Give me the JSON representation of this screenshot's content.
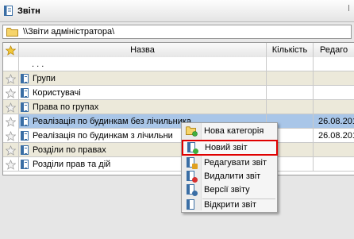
{
  "window": {
    "title": "Звітн"
  },
  "path": {
    "text": "\\\\Звіти адміністратора\\"
  },
  "columns": {
    "name": "Назва",
    "count": "Кількість",
    "edit": "Редаго"
  },
  "rows": [
    {
      "name": ". . .",
      "count": "",
      "edit": ""
    },
    {
      "name": "Групи",
      "count": "",
      "edit": ""
    },
    {
      "name": "Користувачі",
      "count": "",
      "edit": ""
    },
    {
      "name": "Права по групах",
      "count": "",
      "edit": ""
    },
    {
      "name": "Реалізація по будинкам без лічильника",
      "count": "",
      "edit": "26.08.201"
    },
    {
      "name": "Реалізація по будинкам з лічильни",
      "count": "",
      "edit": "26.08.201"
    },
    {
      "name": "Розділи по правах",
      "count": "",
      "edit": ""
    },
    {
      "name": "Розділи прав та дій",
      "count": "",
      "edit": ""
    }
  ],
  "context_menu": {
    "items": [
      {
        "label": "Нова категорія",
        "icon": "new-category-icon"
      },
      {
        "label": "Новий звіт",
        "icon": "new-report-icon"
      },
      {
        "label": "Редагувати звіт",
        "icon": "edit-report-icon"
      },
      {
        "label": "Видалити звіт",
        "icon": "delete-report-icon"
      },
      {
        "label": "Версії звіту",
        "icon": "report-versions-icon"
      },
      {
        "label": "Відкрити звіт",
        "icon": "open-report-icon"
      }
    ]
  },
  "colors": {
    "selection": "#a9c6e8",
    "row_alt": "#ece9da",
    "highlight_box": "#e00000",
    "accent": "#3a6ea5"
  }
}
